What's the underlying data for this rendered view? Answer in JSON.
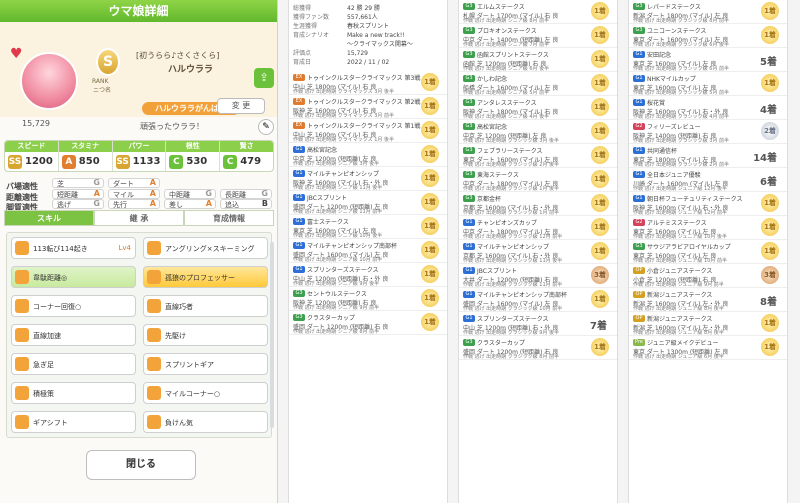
{
  "window_title": "ウマ娘詳細",
  "header": {
    "epithet": "[初うらら♪さくさくら]",
    "name": "ハルウララ",
    "rank": "S",
    "rank_label": "RANK",
    "rank_sub": "ニつ名",
    "badge": "ハルウララがんばる",
    "change_label": "変 更",
    "fans": "15,729",
    "message": "頑張ったウララ！"
  },
  "stats": [
    {
      "name": "スピード",
      "grade": "SS",
      "value": "1200",
      "color": "#d9a531"
    },
    {
      "name": "スタミナ",
      "grade": "A",
      "value": "850",
      "color": "#e27f2e"
    },
    {
      "name": "パワー",
      "grade": "SS",
      "value": "1133",
      "color": "#d9a531"
    },
    {
      "name": "根性",
      "grade": "C",
      "value": "530",
      "color": "#6cc13a"
    },
    {
      "name": "賢さ",
      "grade": "C",
      "value": "479",
      "color": "#6cc13a"
    }
  ],
  "aptitudes": [
    {
      "label": "バ場適性",
      "items": [
        {
          "name": "芝",
          "grade": "G"
        },
        {
          "name": "ダート",
          "grade": "A"
        }
      ]
    },
    {
      "label": "距離適性",
      "items": [
        {
          "name": "短距離",
          "grade": "A"
        },
        {
          "name": "マイル",
          "grade": "A"
        },
        {
          "name": "中距離",
          "grade": "G"
        },
        {
          "name": "長距離",
          "grade": "G"
        }
      ]
    },
    {
      "label": "脚質適性",
      "items": [
        {
          "name": "逃げ",
          "grade": "G"
        },
        {
          "name": "先行",
          "grade": "A"
        },
        {
          "name": "差し",
          "grade": "A"
        },
        {
          "name": "追込",
          "grade": "B"
        }
      ]
    }
  ],
  "tabs": [
    "スキル",
    "継 承",
    "育成情報"
  ],
  "skills": [
    {
      "name": "113転び114起き",
      "lv": "Lv4",
      "style": "plain"
    },
    {
      "name": "アングリング×スキーミング",
      "style": "plain"
    },
    {
      "name": "韋駄距離◎",
      "style": "grn"
    },
    {
      "name": "孤狼のプロフェッサー",
      "style": "gold"
    },
    {
      "name": "コーナー回復○",
      "style": "plain"
    },
    {
      "name": "直線巧者",
      "style": "plain"
    },
    {
      "name": "直線加速",
      "style": "plain"
    },
    {
      "name": "先駆け",
      "style": "plain"
    },
    {
      "name": "急ぎ足",
      "style": "plain"
    },
    {
      "name": "スプリントギア",
      "style": "plain"
    },
    {
      "name": "積極策",
      "style": "plain"
    },
    {
      "name": "マイルコーナー○",
      "style": "plain"
    },
    {
      "name": "ギアシフト",
      "style": "plain"
    },
    {
      "name": "負けん気",
      "style": "plain"
    }
  ],
  "close_label": "閉じる",
  "info": [
    {
      "k": "総獲得",
      "v": "42 勝 29 勝"
    },
    {
      "k": "獲得ファン数",
      "v": "557,661人"
    },
    {
      "k": "生涯獲得",
      "v": "春秋スプリント"
    },
    {
      "k": "育成シナリオ",
      "v": "Make a new track!!"
    },
    {
      "k": "",
      "v": "〜クライマックス開幕〜"
    },
    {
      "k": "評価点",
      "v": "15,729"
    },
    {
      "k": "育成日",
      "v": "2022 / 11 / 02"
    }
  ],
  "races_col1": [
    {
      "g": "EX",
      "n": "トゥインクルスタークライマックス 第3戦",
      "d": "中山 芝 1800m (マイル) 右 良",
      "r": "作戦 逃げ 出走時期 クライマックス 3月 後半",
      "m": "1着"
    },
    {
      "g": "EX",
      "n": "トゥインクルスタークライマックス 第2戦",
      "d": "阪神 芝 1600m (マイル) 右 良",
      "r": "作戦 逃げ 出走時期 クライマックス 3月 前半",
      "m": "1着"
    },
    {
      "g": "EX",
      "n": "トゥインクルスタークライマックス 第1戦",
      "d": "中山 芝 1600m (マイル) 右 良",
      "r": "作戦 逃げ 出走時期 クライマックス 1月 後半",
      "m": "1着"
    },
    {
      "g": "G1",
      "n": "高松宮記念",
      "d": "中京 芝 1200m (短距離) 左 良",
      "r": "作戦 逃げ 出走時期 シニア級 3月 後半",
      "m": "1着"
    },
    {
      "g": "G1",
      "n": "マイルチャンピオンシップ",
      "d": "阪神 芝 1600m (マイル) 右・外 良",
      "r": "作戦 逃げ 出走時期 シニア級 11月 後半",
      "m": "1着"
    },
    {
      "g": "G1",
      "n": "JBCスプリント",
      "d": "盛岡 ダート 1200m (短距離) 左 良",
      "r": "作戦 逃げ 出走時期 シニア級 11月 前半",
      "m": "1着"
    },
    {
      "g": "G1",
      "n": "富士ステークス",
      "d": "東京 芝 1600m (マイル) 左 良",
      "r": "作戦 逃げ 出走時期 シニア級 10月 後半",
      "m": "1着"
    },
    {
      "g": "G1",
      "n": "マイルチャンピオンシップ南部杯",
      "d": "盛岡 ダート 1600m (マイル) 左 良",
      "r": "作戦 逃げ 出走時期 シニア級 10月 前半",
      "m": "1着"
    },
    {
      "g": "G1",
      "n": "スプリンターズステークス",
      "d": "中山 芝 1200m (短距離) 右・外 良",
      "r": "作戦 逃げ 出走時期 シニア級 9月 後半",
      "m": "1着"
    },
    {
      "g": "G3",
      "n": "セントウルステークス",
      "d": "阪神 芝 1200m (短距離) 右 良",
      "r": "作戦 逃げ 出走時期 シニア級 9月 前半",
      "m": "1着"
    },
    {
      "g": "G3",
      "n": "クラスターカップ",
      "d": "盛岡 ダート 1200m (短距離) 右 良",
      "r": "作戦 逃げ 出走時期 シニア級 8月 前半",
      "m": "1着"
    }
  ],
  "races_col2": [
    {
      "g": "G3",
      "n": "エルムステークス",
      "d": "札幌 ダート 1700m (マイル) 右 良",
      "r": "作戦 逃げ 出走時期 シニア級 8月 前半",
      "m": "1着"
    },
    {
      "g": "G3",
      "n": "プロキオンステークス",
      "d": "中京 ダート 1400m (短距離) 左 良",
      "r": "作戦 逃げ 出走時期 シニア級 7月 前半",
      "m": "1着"
    },
    {
      "g": "G3",
      "n": "函館スプリントステークス",
      "d": "函館 芝 1200m (短距離) 右 良",
      "r": "作戦 逃げ 出走時期 シニア級 6月 後半",
      "m": "1着"
    },
    {
      "g": "G3",
      "n": "かしわ記念",
      "d": "船橋 ダート 1600m (マイル) 左 良",
      "r": "作戦 逃げ 出走時期 シニア級 5月 前半",
      "m": "1着"
    },
    {
      "g": "G3",
      "n": "アンタレスステークス",
      "d": "阪神 ダート 1800m (マイル) 右 良",
      "r": "作戦 逃げ 出走時期 シニア級 4月 後半",
      "m": "1着"
    },
    {
      "g": "G3",
      "n": "高松宮記念",
      "d": "中京 芝 1200m (短距離) 左 良",
      "r": "作戦 逃げ 出走時期 クラシック級 3月 後半",
      "m": "1着"
    },
    {
      "g": "G3",
      "n": "フェブラリーステークス",
      "d": "東京 ダート 1600m (マイル) 左 良",
      "r": "作戦 逃げ 出走時期 クラシック級 2月 後半",
      "m": "1着"
    },
    {
      "g": "G3",
      "n": "東海ステークス",
      "d": "中京 ダート 1800m (マイル) 左 良",
      "r": "作戦 逃げ 出走時期 クラシック級 1月 後半",
      "m": "1着"
    },
    {
      "g": "G3",
      "n": "京都金杯",
      "d": "京都 芝 1600m (マイル) 右・外 良",
      "r": "作戦 逃げ 出走時期 クラシック級 1月 前半",
      "m": "1着"
    },
    {
      "g": "G1",
      "n": "チャンピオンズカップ",
      "d": "中京 ダート 1800m (マイル) 左 良",
      "r": "作戦 逃げ 出走時期 クラシック級 12月 前半",
      "m": "1着"
    },
    {
      "g": "G1",
      "n": "マイルチャンピオンシップ",
      "d": "京都 芝 1600m (マイル) 右・外 良",
      "r": "作戦 逃げ 出走時期 クラシック級 11月 後半",
      "m": "1着"
    },
    {
      "g": "G1",
      "n": "JBCスプリント",
      "d": "大井 ダート 1200m (短距離) 右 良",
      "r": "作戦 逃げ 出走時期 クラシック級 11月 前半",
      "m": "3着"
    },
    {
      "g": "G1",
      "n": "マイルチャンピオンシップ南部杯",
      "d": "盛岡 ダート 1600m (マイル) 左 良",
      "r": "作戦 逃げ 出走時期 クラシック級 10月 前半",
      "m": "1着"
    },
    {
      "g": "G1",
      "n": "スプリンターズステークス",
      "d": "中山 芝 1200m (短距離) 右・外 良",
      "r": "作戦 逃げ 出走時期 クラシック級 9月 後半",
      "m": "7着"
    },
    {
      "g": "G3",
      "n": "クラスターカップ",
      "d": "盛岡 ダート 1200m (短距離) 右 良",
      "r": "作戦 逃げ 出走時期 クラシック級 8月 前半",
      "m": "1着"
    }
  ],
  "races_col3": [
    {
      "g": "G3",
      "n": "レパードステークス",
      "d": "新潟 ダート 1800m (マイル) 左 良",
      "r": "作戦 逃げ 出走時期 クラシック級 8月 前半",
      "m": "1着"
    },
    {
      "g": "G3",
      "n": "ユニコーンステークス",
      "d": "東京 ダート 1600m (マイル) 左 良",
      "r": "作戦 逃げ 出走時期 クラシック級 6月 後半",
      "m": "1着"
    },
    {
      "g": "G1",
      "n": "安田記念",
      "d": "東京 芝 1600m (マイル) 左 良",
      "r": "作戦 逃げ 出走時期 クラシック級 6月 前半",
      "m": "5着"
    },
    {
      "g": "G1",
      "n": "NHKマイルカップ",
      "d": "東京 芝 1600m (マイル) 左 良",
      "r": "作戦 逃げ 出走時期 クラシック級 5月 前半",
      "m": "1着"
    },
    {
      "g": "G1",
      "n": "桜花賞",
      "d": "阪神 芝 1600m (マイル) 右・外 良",
      "r": "作戦 逃げ 出走時期 クラシック級 4月 前半",
      "m": "4着"
    },
    {
      "g": "G2",
      "n": "フィリーズレビュー",
      "d": "阪神 芝 1400m (短距離) 右 良",
      "r": "作戦 逃げ 出走時期 クラシック級 3月 前半",
      "m": "2着"
    },
    {
      "g": "G1",
      "n": "共同通信杯",
      "d": "東京 芝 1800m (マイル) 左 良",
      "r": "作戦 逃げ 出走時期 クラシック級 2月 前半",
      "m": "14着"
    },
    {
      "g": "G1",
      "n": "全日本ジュニア優駿",
      "d": "川崎 ダート 1600m (マイル) 左 良",
      "r": "作戦 逃げ 出走時期 ジュニア級 12月 後半",
      "m": "6着"
    },
    {
      "g": "G1",
      "n": "朝日杯フューチュリティステークス",
      "d": "阪神 芝 1600m (マイル) 右・外 良",
      "r": "作戦 逃げ 出走時期 ジュニア級 12月 前半",
      "m": "1着"
    },
    {
      "g": "G2",
      "n": "アルテミスステークス",
      "d": "東京 芝 1600m (マイル) 左 良",
      "r": "作戦 逃げ 出走時期 ジュニア級 10月 後半",
      "m": "1着"
    },
    {
      "g": "G3",
      "n": "サウジアラビアロイヤルカップ",
      "d": "東京 芝 1600m (マイル) 左 良",
      "r": "作戦 逃げ 出走時期 ジュニア級 10月 前半",
      "m": "1着"
    },
    {
      "g": "OP",
      "n": "小倉ジュニアステークス",
      "d": "小倉 芝 1200m (短距離) 右 良",
      "r": "作戦 逃げ 出走時期 ジュニア級 9月 前半",
      "m": "3着"
    },
    {
      "g": "OP",
      "n": "新潟ジュニアステークス",
      "d": "新潟 芝 1600m (マイル) 左・外 良",
      "r": "作戦 逃げ 出走時期 ジュニア級 8月 後半",
      "m": "8着"
    },
    {
      "g": "OP",
      "n": "新潟ジュニアステークス",
      "d": "新潟 芝 1600m (マイル) 左・外 良",
      "r": "作戦 逃げ 出走時期 ジュニア級 8月 後半",
      "m": "1着"
    },
    {
      "g": "Pre",
      "n": "ジュニア級メイクデビュー",
      "d": "東京 ダート 1300m (短距離) 左 良",
      "r": "作戦 逃げ 出走時期 ジュニア級 6月 後半",
      "m": "1着"
    }
  ]
}
